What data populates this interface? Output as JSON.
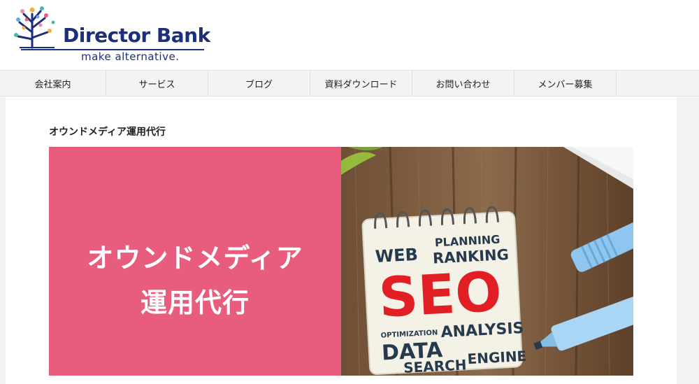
{
  "header": {
    "logo": {
      "name_part1": "Director",
      "name_part2": "Bank",
      "tagline": "make alternative.",
      "colors": {
        "navy": "#1b2f7a",
        "dots": [
          "#f28aa8",
          "#4db6ac",
          "#f5b041",
          "#5dade2",
          "#e85c7e"
        ]
      }
    }
  },
  "nav": {
    "items": [
      {
        "label": "会社案内"
      },
      {
        "label": "サービス"
      },
      {
        "label": "ブログ"
      },
      {
        "label": "資料ダウンロード"
      },
      {
        "label": "お問い合わせ"
      },
      {
        "label": "メンバー募集"
      }
    ]
  },
  "main": {
    "page_title": "オウンドメディア運用代行",
    "banner": {
      "line1": "オウンドメディア",
      "line2": "運用代行",
      "accent_color": "#e85c7e",
      "photo": {
        "notebook_words": {
          "web": "WEB",
          "planning": "PLANNING",
          "ranking": "RANKING",
          "seo": "SEO",
          "optimization": "OPTIMIZATION",
          "analysis": "ANALYSIS",
          "data": "DATA",
          "search": "SEARCH",
          "engine": "ENGINE"
        }
      }
    }
  }
}
